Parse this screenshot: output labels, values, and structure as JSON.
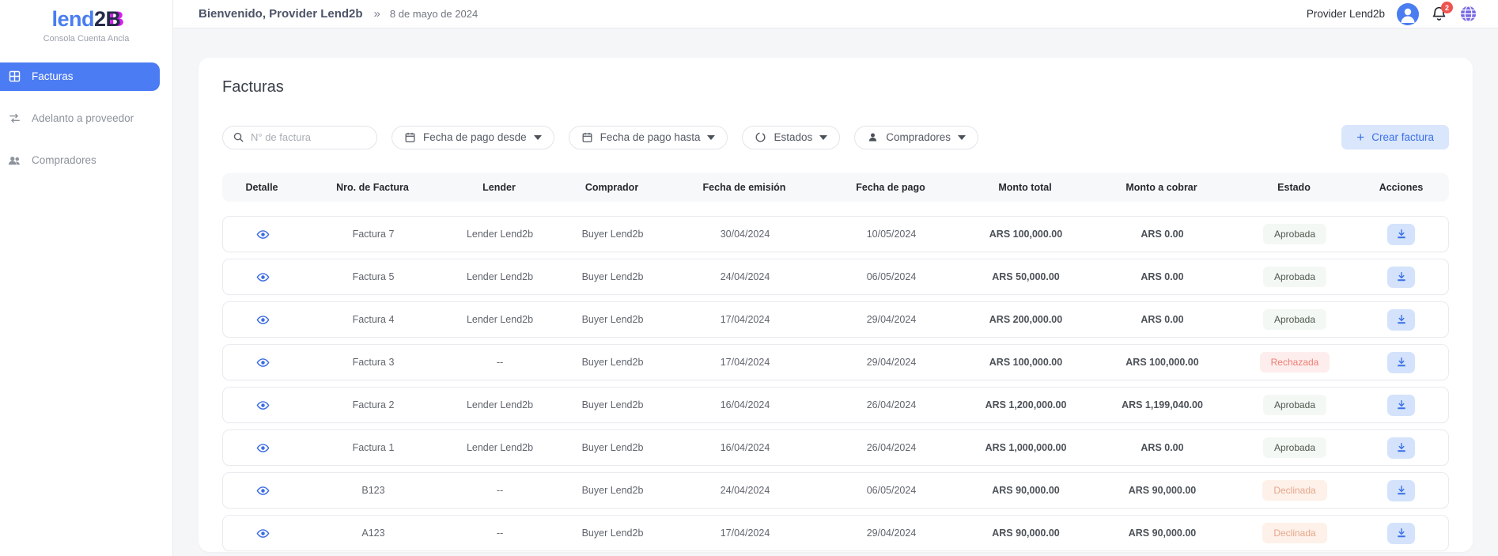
{
  "brand": {
    "logo_blue": "lend",
    "logo_num": "2",
    "logo_b": "B",
    "logo_accent": "B",
    "subtitle": "Consola Cuenta Ancla"
  },
  "sidebar": {
    "items": [
      {
        "label": "Facturas",
        "icon": "grid-icon",
        "active": true
      },
      {
        "label": "Adelanto a proveedor",
        "icon": "transfer-icon",
        "active": false
      },
      {
        "label": "Compradores",
        "icon": "people-icon",
        "active": false
      }
    ]
  },
  "topbar": {
    "welcome": "Bienvenido, Provider Lend2b",
    "separator": "»",
    "date": "8 de mayo de 2024",
    "account_name": "Provider Lend2b",
    "notification_count": "2"
  },
  "page": {
    "title": "Facturas"
  },
  "filters": {
    "search_placeholder": "N° de factura",
    "date_from_label": "Fecha de pago desde",
    "date_to_label": "Fecha de pago hasta",
    "states_label": "Estados",
    "buyers_label": "Compradores",
    "create_plus": "+",
    "create_label": "Crear factura"
  },
  "colors": {
    "accent_blue": "#4c7cf3",
    "approved_text": "#4d584e",
    "rejected_text": "#ed7c73",
    "declined_text": "#e7a78c",
    "badge_red_bg": "#fdeeed",
    "badge_green_bg": "#f4f8f4",
    "badge_orange_bg": "#fdf1e9",
    "globe_purple": "#7668e6",
    "notification_red": "#ef5350"
  },
  "table": {
    "headers": [
      "Detalle",
      "Nro. de Factura",
      "Lender",
      "Comprador",
      "Fecha de emisión",
      "Fecha de pago",
      "Monto total",
      "Monto a cobrar",
      "Estado",
      "Acciones"
    ],
    "rows": [
      {
        "invoice": "Factura 7",
        "lender": "Lender Lend2b",
        "buyer": "Buyer Lend2b",
        "issue_date": "30/04/2024",
        "pay_date": "10/05/2024",
        "total": "ARS 100,000.00",
        "collect": "ARS 0.00",
        "status": "Aprobada",
        "status_type": "approved"
      },
      {
        "invoice": "Factura 5",
        "lender": "Lender Lend2b",
        "buyer": "Buyer Lend2b",
        "issue_date": "24/04/2024",
        "pay_date": "06/05/2024",
        "total": "ARS 50,000.00",
        "collect": "ARS 0.00",
        "status": "Aprobada",
        "status_type": "approved"
      },
      {
        "invoice": "Factura 4",
        "lender": "Lender Lend2b",
        "buyer": "Buyer Lend2b",
        "issue_date": "17/04/2024",
        "pay_date": "29/04/2024",
        "total": "ARS 200,000.00",
        "collect": "ARS 0.00",
        "status": "Aprobada",
        "status_type": "approved"
      },
      {
        "invoice": "Factura 3",
        "lender": "--",
        "buyer": "Buyer Lend2b",
        "issue_date": "17/04/2024",
        "pay_date": "29/04/2024",
        "total": "ARS 100,000.00",
        "collect": "ARS 100,000.00",
        "status": "Rechazada",
        "status_type": "rejected"
      },
      {
        "invoice": "Factura 2",
        "lender": "Lender Lend2b",
        "buyer": "Buyer Lend2b",
        "issue_date": "16/04/2024",
        "pay_date": "26/04/2024",
        "total": "ARS 1,200,000.00",
        "collect": "ARS 1,199,040.00",
        "status": "Aprobada",
        "status_type": "approved"
      },
      {
        "invoice": "Factura 1",
        "lender": "Lender Lend2b",
        "buyer": "Buyer Lend2b",
        "issue_date": "16/04/2024",
        "pay_date": "26/04/2024",
        "total": "ARS 1,000,000.00",
        "collect": "ARS 0.00",
        "status": "Aprobada",
        "status_type": "approved"
      },
      {
        "invoice": "B123",
        "lender": "--",
        "buyer": "Buyer Lend2b",
        "issue_date": "24/04/2024",
        "pay_date": "06/05/2024",
        "total": "ARS 90,000.00",
        "collect": "ARS 90,000.00",
        "status": "Declinada",
        "status_type": "declined"
      },
      {
        "invoice": "A123",
        "lender": "--",
        "buyer": "Buyer Lend2b",
        "issue_date": "17/04/2024",
        "pay_date": "29/04/2024",
        "total": "ARS 90,000.00",
        "collect": "ARS 90,000.00",
        "status": "Declinada",
        "status_type": "declined"
      }
    ]
  }
}
